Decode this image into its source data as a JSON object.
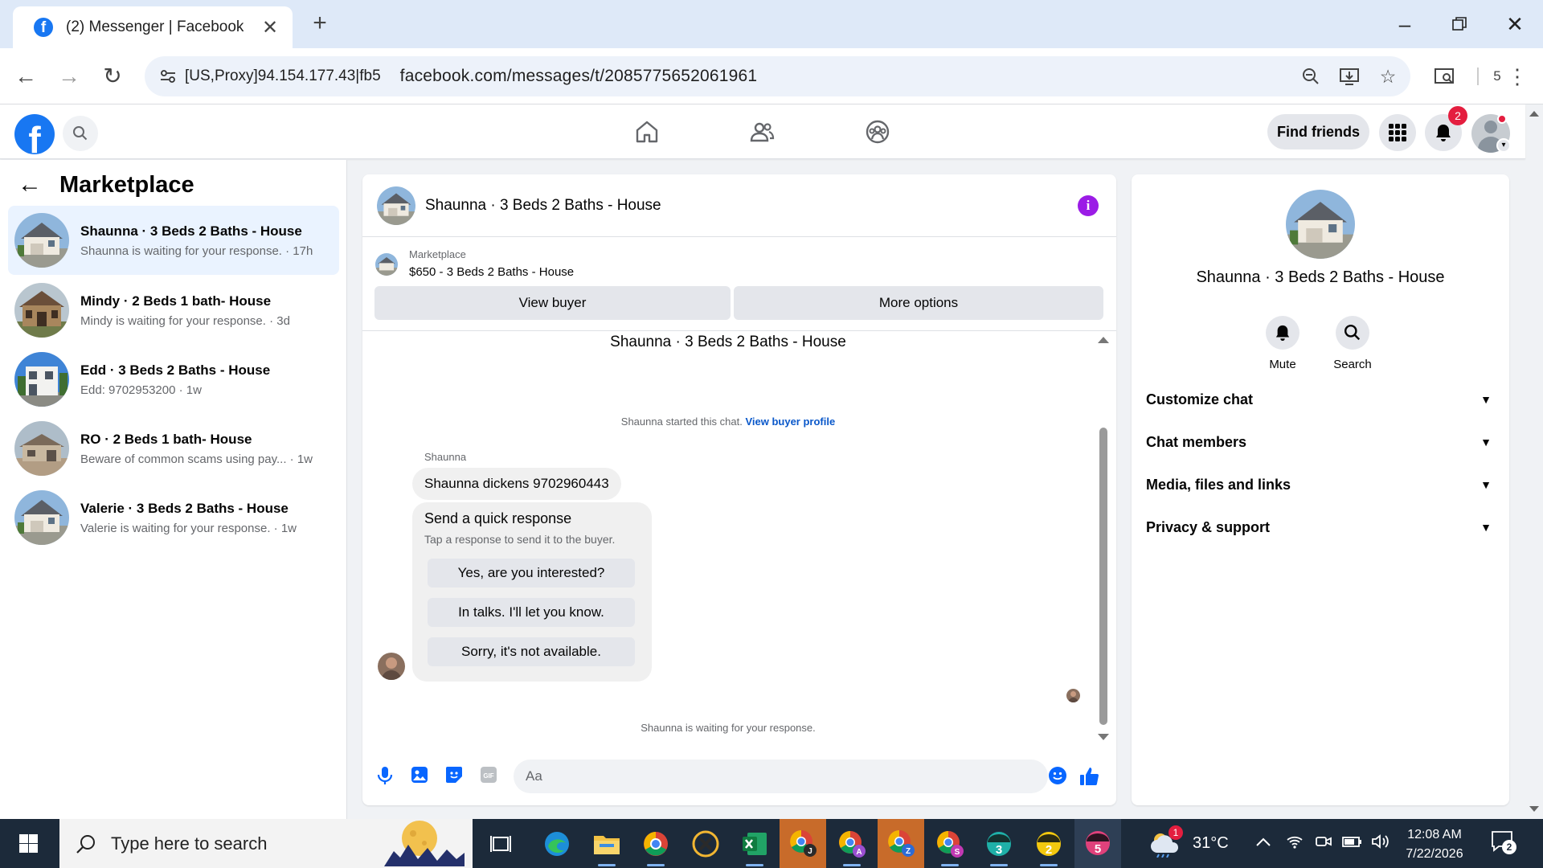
{
  "browser": {
    "tab_title": "(2) Messenger | Facebook",
    "tab_close": "✕",
    "new_tab": "+",
    "proxy_label": "[US,Proxy]94.154.177.43|fb5",
    "url": "facebook.com/messages/t/2085775652061961",
    "extension_count": "5"
  },
  "fb_header": {
    "find_friends": "Find friends",
    "notifications_count": "2"
  },
  "left_panel": {
    "title": "Marketplace",
    "conversations": [
      {
        "name": "Shaunna · 3 Beds 2 Baths - House",
        "preview": "Shaunna is waiting for your response. · 17h",
        "active": true
      },
      {
        "name": "Mindy · 2 Beds 1 bath- House",
        "preview": "Mindy is waiting for your response. · 3d",
        "active": false
      },
      {
        "name": "Edd · 3 Beds 2 Baths - House",
        "preview": "Edd: 9702953200 · 1w",
        "active": false
      },
      {
        "name": "RO · 2 Beds 1 bath- House",
        "preview": "Beware of common scams using pay... · 1w",
        "active": false
      },
      {
        "name": "Valerie · 3 Beds 2 Baths - House",
        "preview": "Valerie is waiting for your response. · 1w",
        "active": false
      }
    ]
  },
  "chat": {
    "header_name": "Shaunna · 3 Beds 2 Baths - House",
    "listing_kind": "Marketplace",
    "listing_price": "$650 - 3 Beds 2 Baths - House",
    "view_buyer": "View buyer",
    "more_options": "More options",
    "thread_title": "Shaunna · 3 Beds 2 Baths - House",
    "started_text": "Shaunna started this chat.",
    "view_buyer_profile": "View buyer profile",
    "sender_name": "Shaunna",
    "message_text": "Shaunna dickens 9702960443",
    "quick_title": "Send a quick response",
    "quick_subtitle": "Tap a response to send it to the buyer.",
    "quick_replies": [
      "Yes, are you interested?",
      "In talks. I'll let you know.",
      "Sorry, it's not available."
    ],
    "waiting_text": "Shaunna is waiting for your response.",
    "composer_placeholder": "Aa"
  },
  "right_panel": {
    "name": "Shaunna · 3 Beds 2 Baths - House",
    "mute_label": "Mute",
    "search_label": "Search",
    "sections": [
      "Customize chat",
      "Chat members",
      "Media, files and links",
      "Privacy & support"
    ]
  },
  "taskbar": {
    "search_placeholder": "Type here to search",
    "temperature": "31°C",
    "weather_badge": "1",
    "time": "12:08 AM",
    "date": "7/22/2026",
    "notif_count": "2",
    "app_badges": [
      "J",
      "A",
      "Z",
      "S",
      "3",
      "2",
      "5"
    ]
  },
  "colors": {
    "facebook_blue": "#1877f2",
    "messenger_blue": "#0866ff",
    "info_purple": "#9b1ce6",
    "notification_red": "#e41e3f",
    "taskbar": "#1c2a3a"
  }
}
